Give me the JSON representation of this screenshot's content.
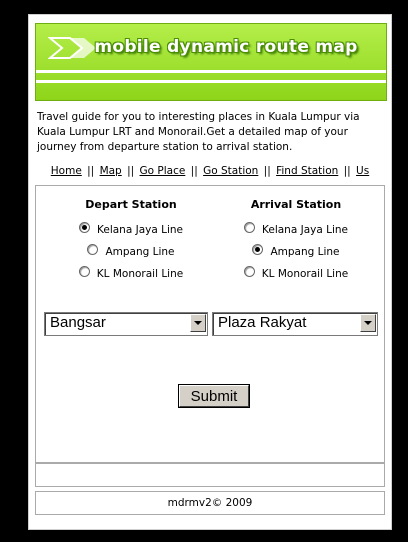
{
  "header": {
    "title": "mobile dynamic route map"
  },
  "intro": "Travel guide for you to interesting places in Kuala Lumpur via Kuala Lumpur LRT and Monorail.Get a detailed map of your journey from departure station to arrival station.",
  "nav": [
    {
      "label": "Home"
    },
    {
      "label": "Map"
    },
    {
      "label": "Go Place"
    },
    {
      "label": "Go Station"
    },
    {
      "label": "Find Station"
    },
    {
      "label": "Us"
    }
  ],
  "nav_separator": "||",
  "depart": {
    "heading": "Depart Station",
    "lines": [
      "Kelana Jaya Line",
      "Ampang Line",
      "KL Monorail Line"
    ],
    "selected_line": "Kelana Jaya Line",
    "station": "Bangsar"
  },
  "arrival": {
    "heading": "Arrival Station",
    "lines": [
      "Kelana Jaya Line",
      "Ampang Line",
      "KL Monorail Line"
    ],
    "selected_line": "Ampang Line",
    "station": "Plaza Rakyat"
  },
  "submit_label": "Submit",
  "footer": "mdrmv2© 2009",
  "colors": {
    "banner": "#9ad925",
    "background": "#000000"
  }
}
